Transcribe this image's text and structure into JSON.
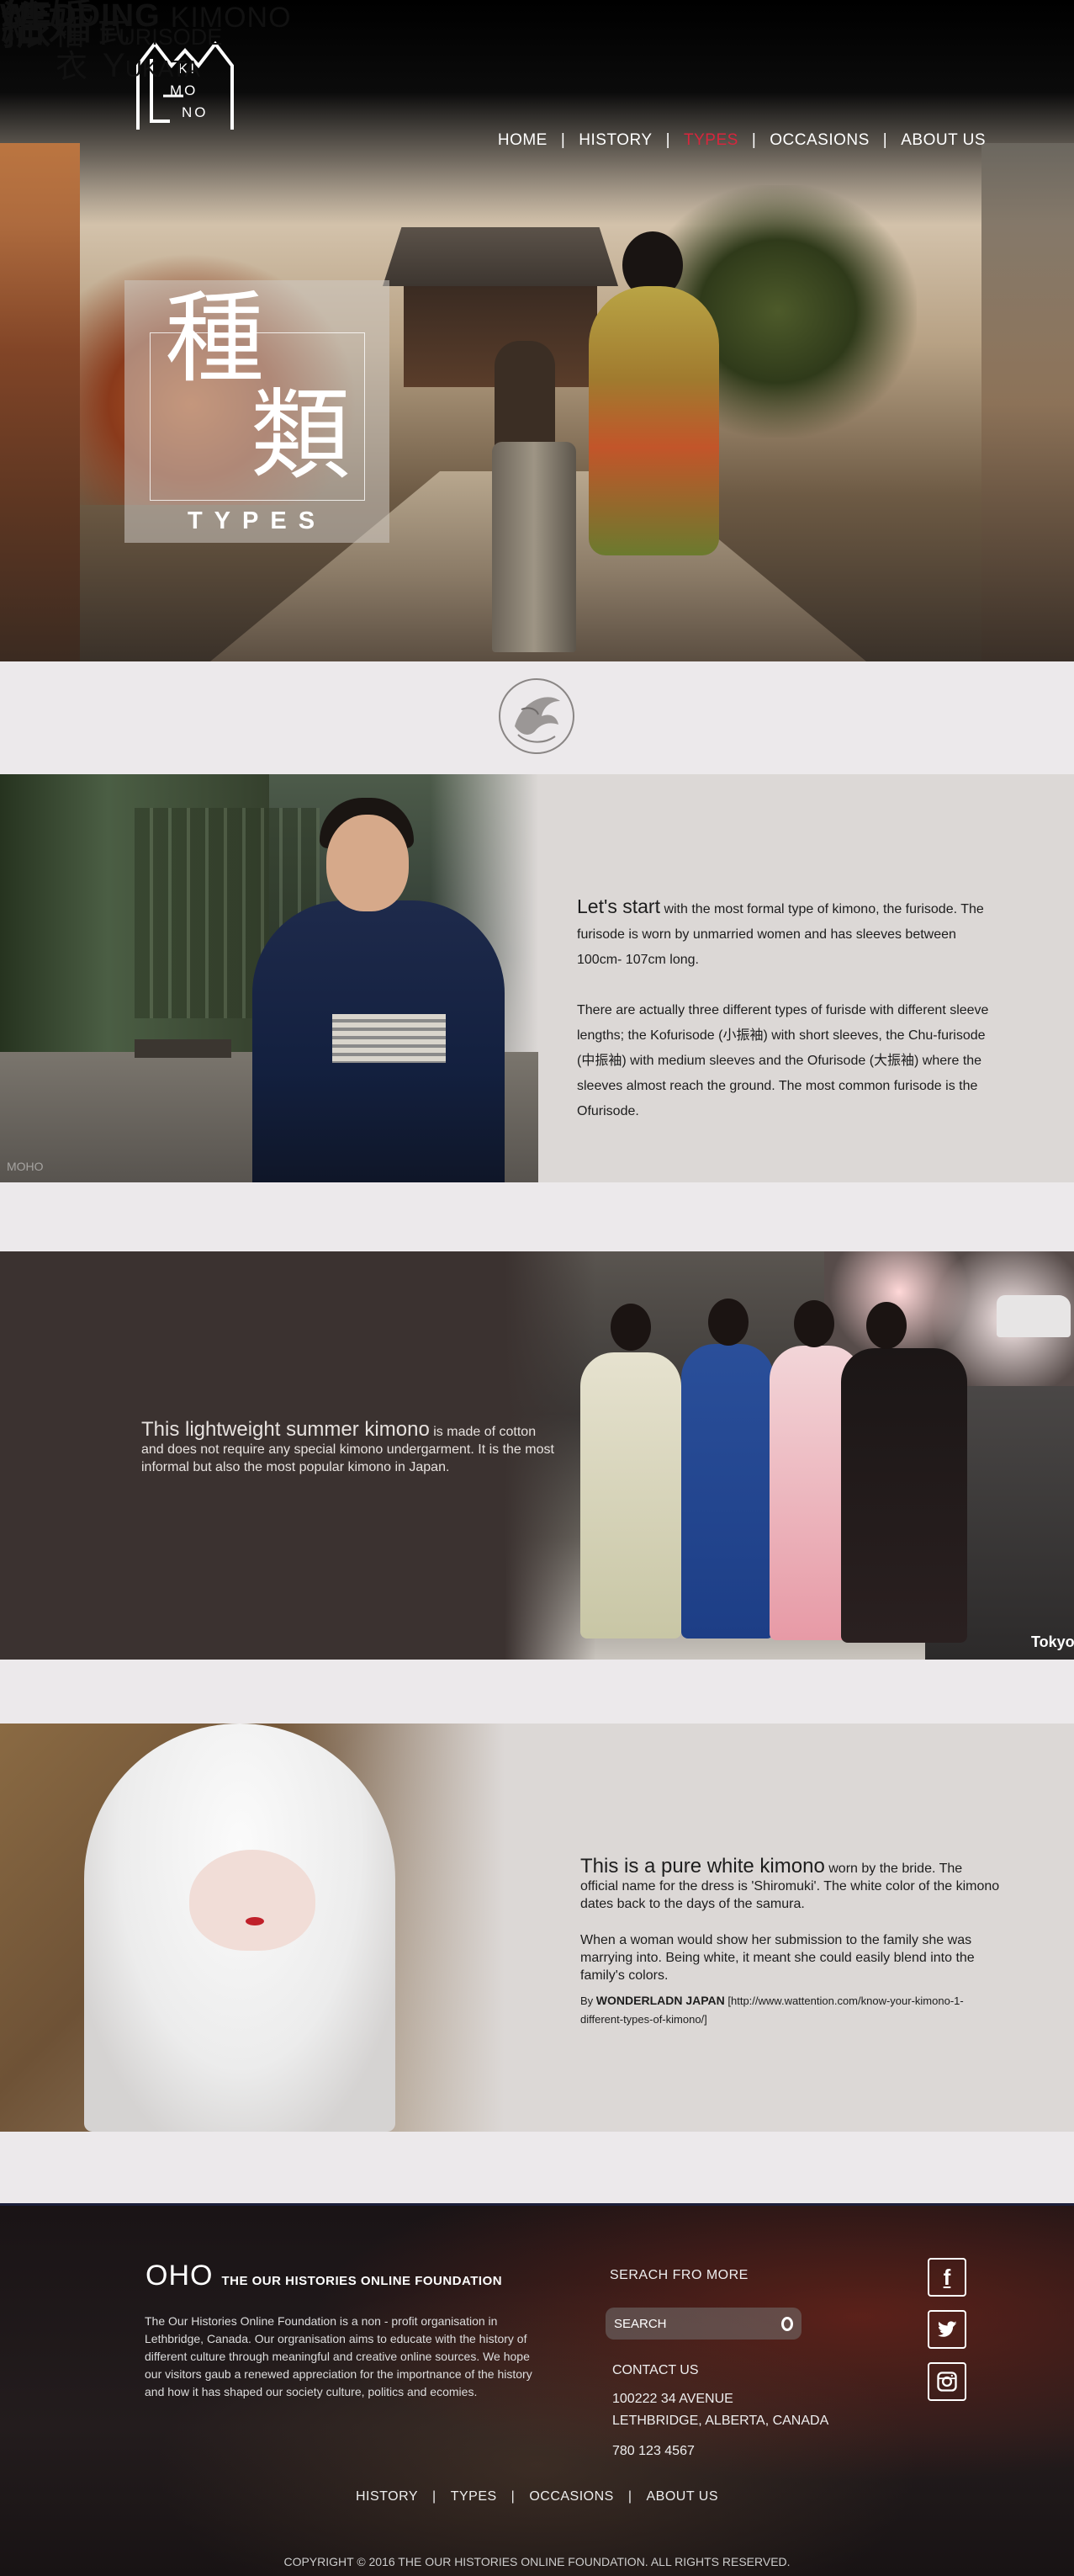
{
  "logo": {
    "letters": [
      "KI",
      "MO",
      "NO"
    ]
  },
  "nav": {
    "items": [
      "HOME",
      "HISTORY",
      "TYPES",
      "OCCASIONS",
      "ABOUT US"
    ],
    "active_index": 2,
    "active_color": "#d7263d"
  },
  "hero": {
    "kanji_1": "種",
    "kanji_2": "類",
    "subtitle": "TYPES"
  },
  "emblem": {
    "icon": "phoenix-emblem-icon"
  },
  "furisode": {
    "kanji_big": "振",
    "kanji_small": "袖",
    "title": "Furisode",
    "lead": "Let's start",
    "p1_rest": " with the most formal type of kimono, the furisode. The furisode is worn by unmarried women and has sleeves between 100cm- 107cm long.",
    "p2": "There are actually three different types of furisde with different sleeve lengths; the Kofurisode (小振袖) with short sleeves, the Chu-furisode (中振袖) with medium sleeves and the Ofurisode (大振袖) where the sleeves almost reach the ground. The most common furisode is the Ofurisode.",
    "watermark": "MOHO"
  },
  "yukata": {
    "kanji_big": "浴",
    "kanji_small": "衣",
    "title": "Yukata",
    "lead": "This lightweight summer kimono",
    "rest": " is made of cotton and does not require any special kimono undergarment. It is the most informal but also the most popular kimono in Japan.",
    "watermark": "Tokyo"
  },
  "wedding": {
    "kanji_big": "結婚",
    "kanji_small": "式",
    "title_bold": "WEDDING",
    "title_light": "KIMONO",
    "lead": "This is a pure white kimono",
    "p1_rest": " worn by the bride. The official name for the dress is 'Shiromuki'. The white color of the kimono dates back to the days of the samura.",
    "p2": "When a woman would show her submission to the family she was marrying into. Being white, it meant she could easily blend into the family's colors.",
    "credit_by": "By ",
    "credit_name": "WONDERLADN JAPAN",
    "credit_url": " [http://www.wattention.com/know-your-kimono-1-different-types-of-kimono/]"
  },
  "footer": {
    "oho": "OHO",
    "foundation": "THE OUR HISTORIES ONLINE FOUNDATION",
    "about": "The Our Histories Online Foundation is a non - profit organisation in Lethbridge, Canada. Our orgranisation aims to educate with the history of different culture through meaningful and creative online sources. We hope our visitors gaub a renewed appreciation for the importnance of the history and how it has shaped our society culture, politics and ecomies.",
    "search_label": "SERACH FRO MORE",
    "search_placeholder": "SEARCH",
    "contact_heading": "CONTACT US",
    "address_1": "100222 34 AVENUE",
    "address_2": "LETHBRIDGE, ALBERTA, CANADA",
    "phone": "780 123 4567",
    "social": {
      "facebook": "f",
      "twitter": "twitter-bird-icon",
      "instagram": "camera-icon"
    },
    "nav": [
      "HISTORY",
      "TYPES",
      "OCCASIONS",
      "ABOUT US"
    ],
    "copyright": "COPYRIGHT © 2016 THE OUR HISTORIES ONLINE FOUNDATION. ALL RIGHTS RESERVED."
  }
}
